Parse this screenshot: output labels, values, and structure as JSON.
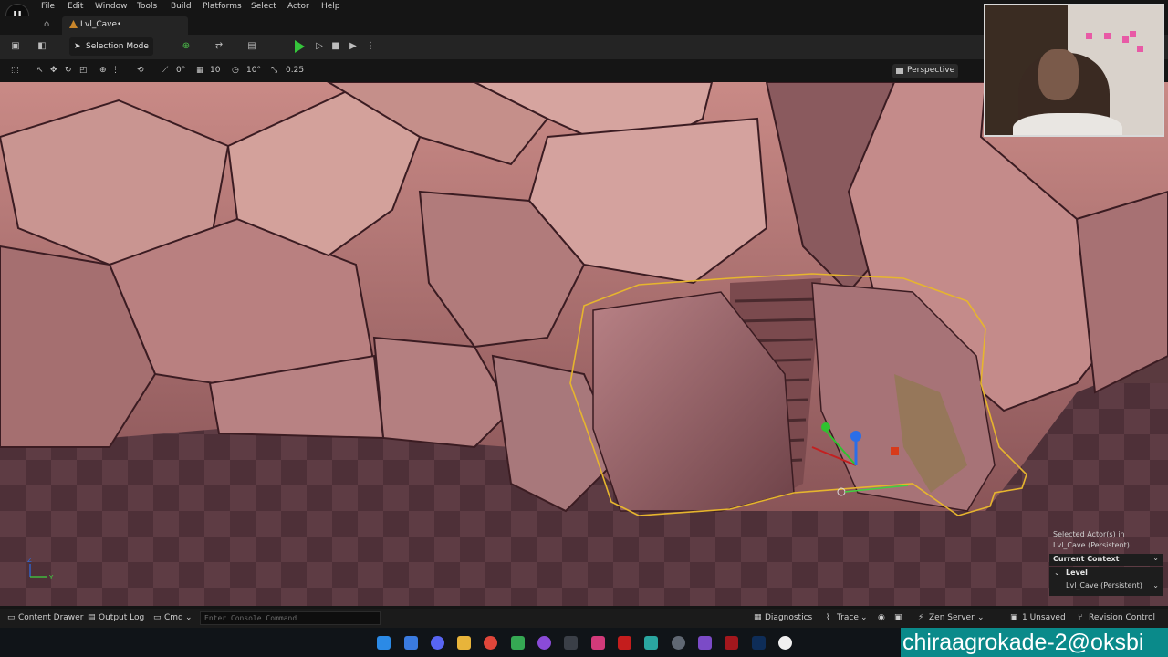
{
  "app": {
    "logo_text": "U"
  },
  "menu": {
    "items": [
      "File",
      "Edit",
      "Window",
      "Tools",
      "Build",
      "Platforms",
      "Select",
      "Actor",
      "Help"
    ]
  },
  "tabs": {
    "level_tab": "Lvl_Cave•"
  },
  "toolbar": {
    "selection_mode": "Selection Mode"
  },
  "viewport_toolbar": {
    "rotation_snap": "0°",
    "grid_snap": "10",
    "angle_snap": "10°",
    "scale_snap": "0.25",
    "view_mode": "Perspective"
  },
  "context": {
    "selected_actor_label": "Selected Actor(s) in",
    "selected_actor_level": "Lvl_Cave (Persistent)",
    "current_context": "Current Context",
    "level_label": "Level",
    "level_value": "Lvl_Cave (Persistent)"
  },
  "status": {
    "content_drawer": "Content Drawer",
    "output_log": "Output Log",
    "cmd": "Cmd",
    "console_placeholder": "Enter Console Command",
    "diagnostics": "Diagnostics",
    "trace": "Trace",
    "zen_server": "Zen Server",
    "unsaved": "1 Unsaved",
    "revision_control": "Revision Control"
  },
  "watermark": {
    "text": "chiraagrokade-2@oksbi"
  },
  "colors": {
    "selection_outline": "#e6b52e",
    "play": "#35c53b",
    "watermark_bg": "#0a8a8a"
  }
}
